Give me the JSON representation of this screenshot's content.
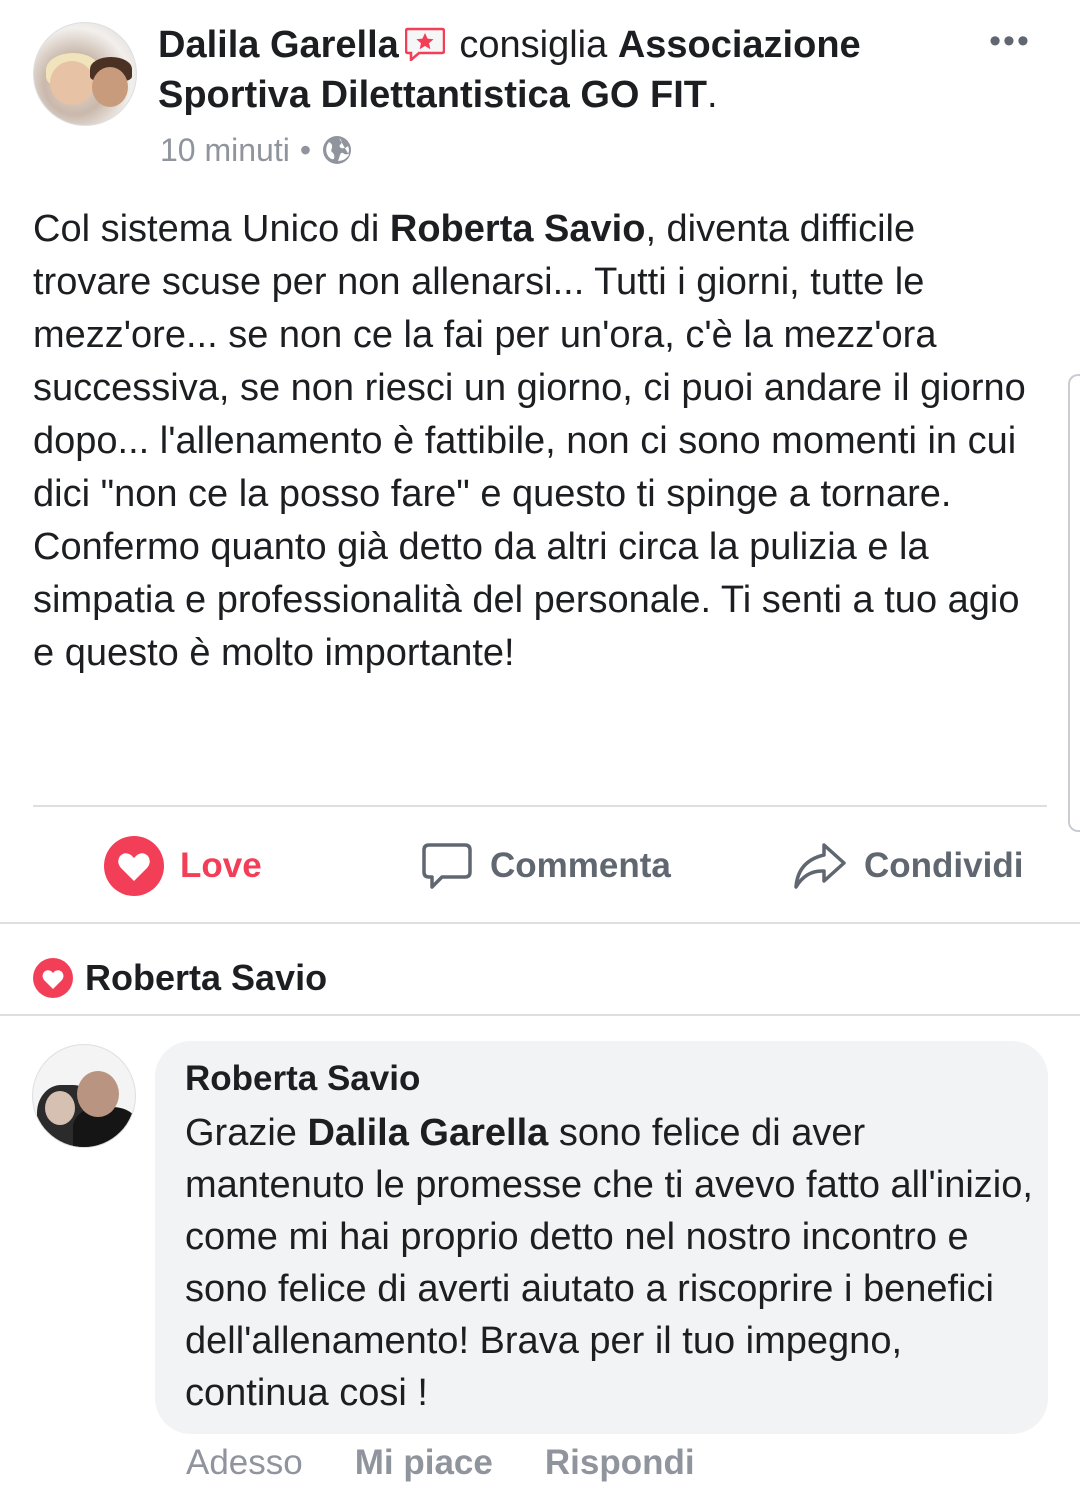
{
  "post": {
    "author": "Dalila Garella",
    "verb": "consiglia",
    "page_name": "Associazione Sportiva Dilettantistica GO FIT",
    "page_name_line1": "Associazione",
    "page_name_line2": "Sportiva Dilettantistica GO FIT",
    "period": ".",
    "time": "10 minuti",
    "dot": "•",
    "privacy_icon": "globe-icon",
    "more_label": "•••",
    "body": {
      "part1": "Col sistema Unico di ",
      "mention": "Roberta Savio",
      "part2": ", diventa difficile trovare scuse per non allenarsi... Tutti i giorni, tutte le mezz'ore... se non ce la fai per un'ora, c'è la mezz'ora successiva, se non riesci un giorno, ci puoi andare il giorno dopo... l'allenamento è fattibile, non ci sono momenti in cui dici \"non ce la posso fare\" e questo ti spinge a tornare. Confermo quanto già detto da altri circa la pulizia e la simpatia e professionalità del personale. Ti senti a tuo agio e questo è molto importante!"
    }
  },
  "actions": {
    "love": "Love",
    "comment": "Commenta",
    "share": "Condividi"
  },
  "reactions": {
    "name": "Roberta Savio",
    "icon": "heart-icon"
  },
  "comment": {
    "author": "Roberta Savio",
    "part1": "Grazie ",
    "mention": "Dalila Garella",
    "part2": " sono felice di aver mantenuto le promesse che ti avevo fatto all'inizio, come mi hai proprio detto nel nostro incontro e sono felice di averti aiutato a riscoprire i benefici dell'allenamento! Brava per il tuo impegno, continua cosi !",
    "time": "Adesso",
    "like": "Mi piace",
    "reply": "Rispondi"
  },
  "colors": {
    "love": "#f33e58",
    "text": "#1c1e21",
    "muted": "#90949c",
    "action_gray": "#606770",
    "bubble": "#f2f3f5",
    "divider": "#dddfe2"
  }
}
